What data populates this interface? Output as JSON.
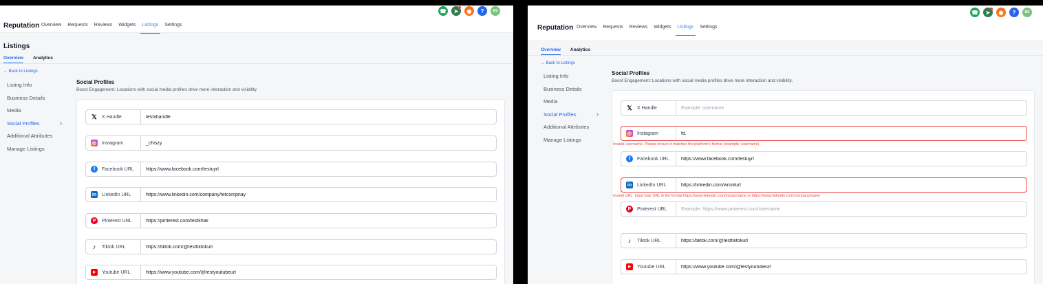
{
  "colors": {
    "accent": "#3b82f6",
    "error": "#ef4444",
    "phone": "#22a35a",
    "orange": "#f97316",
    "help": "#2563eb",
    "avatar": "#7cc27f"
  },
  "header": {
    "brand": "Reputation",
    "tabs": [
      "Overview",
      "Requests",
      "Reviews",
      "Widgets",
      "Listings",
      "Settings"
    ],
    "active_tab": "Listings",
    "icons": [
      "phone-icon",
      "megaphone-icon",
      "bell-icon",
      "help-icon",
      "avatar"
    ],
    "help_glyph": "?",
    "avatar_initials": "BS"
  },
  "left": {
    "page_title": "Listings",
    "subtabs": [
      "Overview",
      "Analytics"
    ],
    "back": "← Back to Listings",
    "sidebar": [
      "Listing Info",
      "Business Details",
      "Media",
      "Social Profiles",
      "Additional Attributes",
      "Manage Listings"
    ],
    "section_title": "Social Profiles",
    "section_sub": "Boost Engagement: Locations with social media profiles drive more interaction and visibility.",
    "rows": [
      {
        "label": "X Handle",
        "value": "testxhandle"
      },
      {
        "label": "Instagram",
        "value": "_chiszy"
      },
      {
        "label": "Facebook URL",
        "value": "https://www.facebook.com/testuyrl"
      },
      {
        "label": "LinkedIn URL",
        "value": "https://www.linkedin.com/company/tetcompnay"
      },
      {
        "label": "Pinterest URL",
        "value": "https://pinterest.com/testkhali"
      },
      {
        "label": "Tiktok URL",
        "value": "https://tiktok.com/@testtiktokurl"
      },
      {
        "label": "Youtube URL",
        "value": "https://www.youtube.com/@testyoutubeurl"
      }
    ]
  },
  "right": {
    "subtabs": [
      "Overview",
      "Analytics"
    ],
    "back": "← Back to Listings",
    "sidebar": [
      "Listing Info",
      "Business Details",
      "Media",
      "Social Profiles",
      "Additional Attributes",
      "Manage Listings"
    ],
    "section_title": "Social Profiles",
    "section_sub": "Boost Engagement: Locations with social media profiles drive more interaction and visibility.",
    "rows": [
      {
        "label": "X Handle",
        "value": "",
        "placeholder": "Example: username"
      },
      {
        "label": "Instagram",
        "value": "fd.",
        "error": "Invalid Username. Please ensure it matches the platform's format (example: username)"
      },
      {
        "label": "Facebook URL",
        "value": "https://www.facebook.com/testuyrl"
      },
      {
        "label": "LinkedIn URL",
        "value": "https://linkedin.com/wronturl",
        "error": "Invalid URL. Input your URL in the format https://www.linkedin.com/in/username or https://www.linkedin.com/company/name"
      },
      {
        "label": "Pinterest URL",
        "value": "",
        "placeholder": "Example: https://www.pinterest.com/username"
      },
      {
        "label": "Tiktok URL",
        "value": "https://tiktok.com/@testtiktokurl"
      },
      {
        "label": "Youtube URL",
        "value": "https://www.youtube.com/@testyoutubeurl"
      }
    ]
  }
}
